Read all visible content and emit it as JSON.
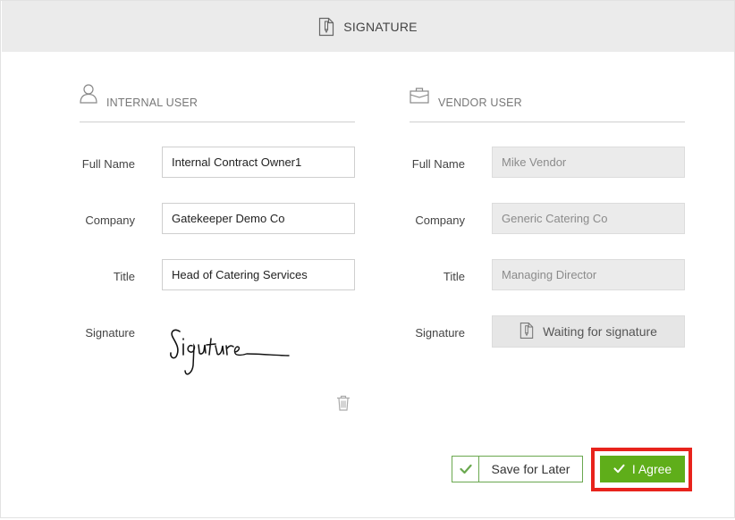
{
  "header": {
    "title": "SIGNATURE",
    "icon": "document-signature-icon"
  },
  "internal": {
    "heading": "INTERNAL USER",
    "icon": "user-icon",
    "full_name_label": "Full Name",
    "full_name": "Internal Contract Owner1",
    "company_label": "Company",
    "company": "Gatekeeper Demo Co",
    "title_label": "Title",
    "title": "Head of Catering Services",
    "signature_label": "Signature"
  },
  "vendor": {
    "heading": "VENDOR USER",
    "icon": "briefcase-icon",
    "full_name_label": "Full Name",
    "full_name": "Mike Vendor",
    "company_label": "Company",
    "company": "Generic Catering Co",
    "title_label": "Title",
    "title": "Managing Director",
    "signature_label": "Signature",
    "waiting_label": "Waiting for signature"
  },
  "actions": {
    "save_label": "Save for Later",
    "agree_label": "I Agree"
  },
  "colors": {
    "accent_green": "#5fae1a",
    "highlight_red": "#e8231c",
    "header_bg": "#ebebeb"
  }
}
